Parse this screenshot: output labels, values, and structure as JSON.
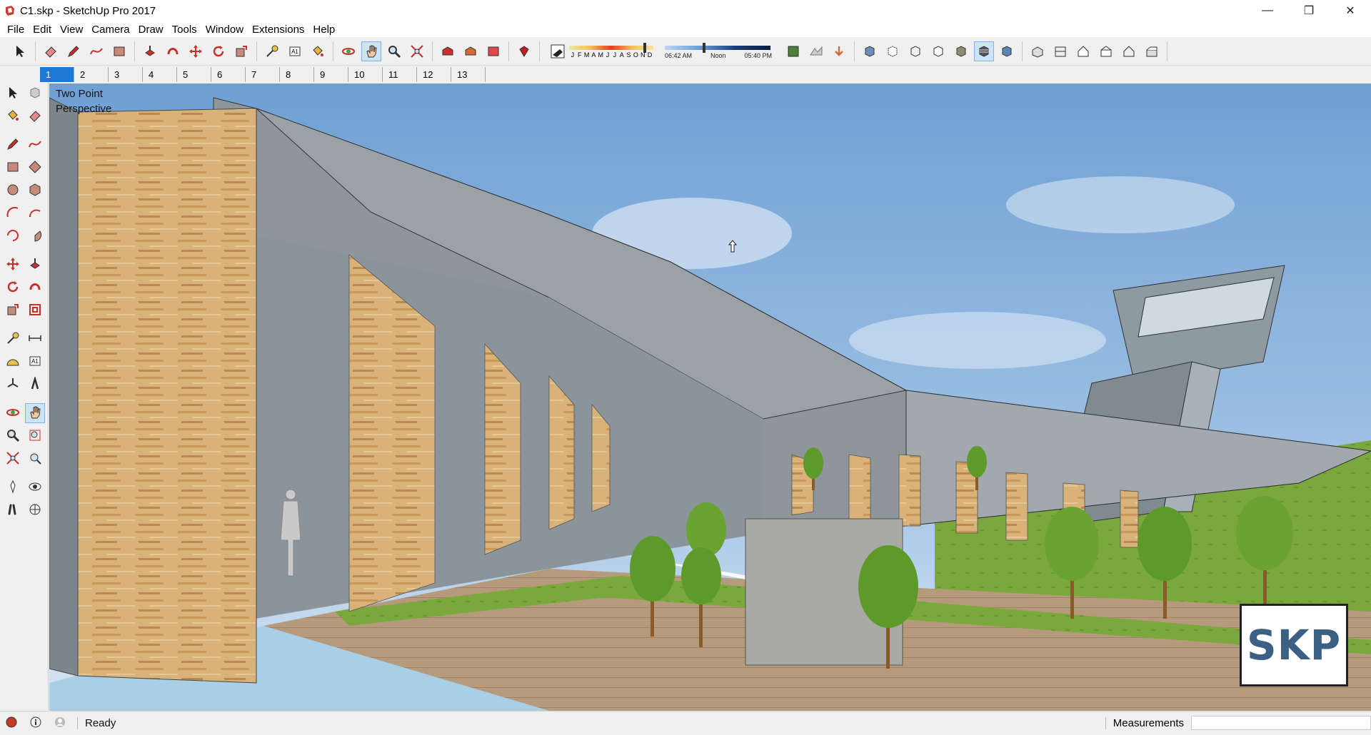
{
  "window": {
    "title": "C1.skp - SketchUp Pro 2017",
    "controls": [
      "minimize",
      "restore",
      "close"
    ]
  },
  "menu": [
    "File",
    "Edit",
    "View",
    "Camera",
    "Draw",
    "Tools",
    "Window",
    "Extensions",
    "Help"
  ],
  "toolbar": {
    "groups": [
      [
        "select-icon"
      ],
      [
        "eraser-icon",
        "pencil-icon",
        "freehand-icon",
        "rectangle-icon"
      ],
      [
        "push-pull-icon",
        "follow-me-icon",
        "move-icon",
        "rotate-icon",
        "scale-icon"
      ],
      [
        "tape-measure-icon",
        "text-icon",
        "paint-bucket-icon"
      ],
      [
        "orbit-icon",
        "pan-icon",
        "zoom-icon",
        "zoom-extents-icon"
      ],
      [
        "3d-warehouse-icon",
        "extension-warehouse-icon",
        "layout-icon"
      ],
      [
        "ruby-icon"
      ],
      [
        "shadows-toggle-icon"
      ]
    ],
    "shadow": {
      "months": [
        "J",
        "F",
        "M",
        "A",
        "M",
        "J",
        "J",
        "A",
        "S",
        "O",
        "N",
        "D"
      ],
      "time_start": "06:42 AM",
      "time_mid": "Noon",
      "time_end": "05:40 PM",
      "date_position": 0.88,
      "time_position": 0.36
    },
    "right_groups": [
      [
        "add-location-icon",
        "toggle-terrain-icon",
        "photo-textures-icon"
      ],
      [
        "xray-icon",
        "back-edges-icon",
        "wireframe-icon",
        "hidden-line-icon",
        "shaded-icon",
        "shaded-textures-icon",
        "monochrome-icon"
      ],
      [
        "iso-view-icon",
        "top-view-icon",
        "front-view-icon",
        "right-view-icon",
        "back-view-icon",
        "left-view-icon"
      ]
    ],
    "active": [
      "pan-icon",
      "shaded-textures-icon"
    ]
  },
  "scenes": {
    "tabs": [
      "1",
      "2",
      "3",
      "4",
      "5",
      "6",
      "7",
      "8",
      "9",
      "10",
      "11",
      "12",
      "13"
    ],
    "active": "1"
  },
  "left_toolbar": {
    "rows": [
      [
        "select-icon",
        "make-component-icon"
      ],
      [
        "paint-bucket-icon",
        "eraser-icon"
      ],
      null,
      [
        "line-icon",
        "freehand-icon"
      ],
      [
        "rectangle-icon",
        "rotated-rectangle-icon"
      ],
      [
        "circle-icon",
        "polygon-icon"
      ],
      [
        "arc-icon",
        "two-point-arc-icon"
      ],
      [
        "three-point-arc-icon",
        "pie-icon"
      ],
      null,
      [
        "move-icon",
        "push-pull-icon"
      ],
      [
        "rotate-icon",
        "follow-me-icon"
      ],
      [
        "scale-icon",
        "offset-icon"
      ],
      null,
      [
        "tape-measure-icon",
        "dimension-icon"
      ],
      [
        "protractor-icon",
        "text-icon"
      ],
      [
        "axes-icon",
        "3d-text-icon"
      ],
      null,
      [
        "orbit-icon",
        "pan-icon"
      ],
      [
        "zoom-icon",
        "zoom-window-icon"
      ],
      [
        "zoom-extents-icon",
        "previous-view-icon"
      ],
      null,
      [
        "position-camera-icon",
        "look-around-icon"
      ],
      [
        "walk-icon",
        "section-plane-icon"
      ]
    ],
    "active": "pan-icon"
  },
  "viewport": {
    "camera_label": "Two Point\nPerspective",
    "logo_text": "SKP"
  },
  "status": {
    "text": "Ready",
    "measurements_label": "Measurements",
    "measurements_value": ""
  },
  "colors": {
    "sky_top": "#6fa0d4",
    "sky_bottom": "#c7dcef",
    "wood": "#d9b27a",
    "concrete": "#9a9a9a",
    "grass": "#7aa83c",
    "active_tab": "#1e78d6"
  }
}
